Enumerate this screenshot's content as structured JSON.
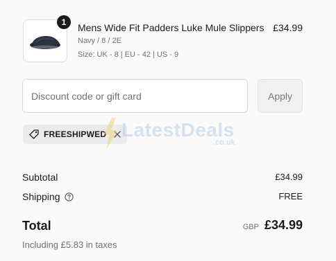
{
  "product": {
    "quantity": "1",
    "title": "Mens Wide Fit Padders Luke Mule Slippers",
    "variant": "Navy / 8 / 2E",
    "size": "Size: UK - 8 | EU - 42 | US - 9",
    "price": "£34.99",
    "image_icon": "slipper-icon"
  },
  "discount": {
    "placeholder": "Discount code or gift card",
    "value": "",
    "apply_label": "Apply",
    "applied_code": "FREESHIPWED"
  },
  "watermark": {
    "text": "LatestDeals",
    "sub": ".co.uk"
  },
  "summary": {
    "subtotal_label": "Subtotal",
    "subtotal_value": "£34.99",
    "shipping_label": "Shipping",
    "shipping_value": "FREE",
    "total_label": "Total",
    "currency": "GBP",
    "total_value": "£34.99",
    "taxes_note": "Including £5.83 in taxes"
  },
  "colors": {
    "text": "#1a1a1a",
    "muted": "#707070",
    "background": "#fafafa"
  }
}
